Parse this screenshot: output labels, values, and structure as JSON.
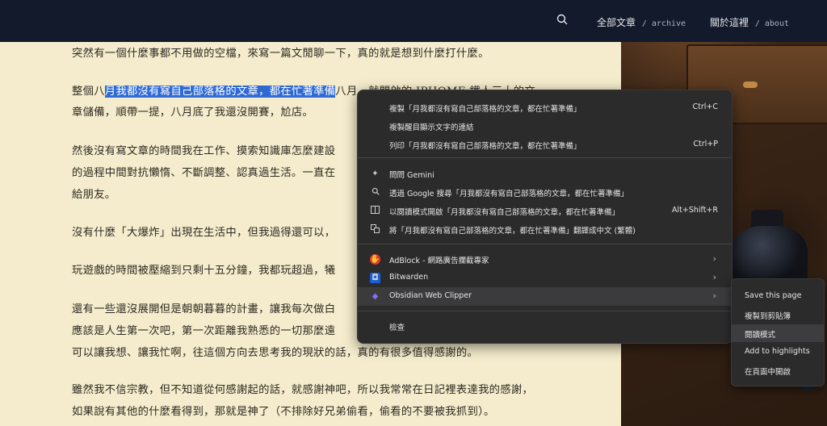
{
  "nav": {
    "items": [
      {
        "label": "全部文章",
        "sub": "/ archive"
      },
      {
        "label": "關於這裡",
        "sub": "/ about"
      }
    ]
  },
  "article": {
    "p1": "突然有一個什麼事都不用做的空檔，來寫一篇文閒聊一下，真的就是想到什麼打什麼。",
    "p2_pre": "整個八",
    "p2_sel": "月我都沒有寫自己部落格的文章，都在忙著準備",
    "p2_post": "八月...就開啟的 IPHOME 鐵人三十的文",
    "p2_l2": "章儲備，順帶一提，八月底了我還沒開賽，尬店。",
    "p3_l1": "然後沒有寫文章的時間我在工作、摸索知識庫怎麼建設",
    "p3_l2": "的過程中間對抗懶惰、不斷調整、認真過生活。一直在",
    "p3_l3": "給朋友。",
    "p4": "沒有什麼「大爆炸」出現在生活中，但我過得還可以，",
    "p5": "玩遊戲的時間被壓縮到只剩十五分鐘，我都玩超過，犧",
    "p6_l1": "還有一些還沒展開但是朝朝暮暮的計畫，讓我每次做白",
    "p6_l2": "應該是人生第一次吧，第一次距離我熟悉的一切那麼遠",
    "p6_l3": "可以讓我想、讓我忙啊，往這個方向去思考我的現狀的話，真的有很多值得感謝的。",
    "p7_l1": "雖然我不信宗教，但不知道從何感謝起的話，就感謝神吧，所以我常常在日記裡表達我的感謝，",
    "p7_l2": "如果說有其他的什麼看得到，那就是神了（不排除好兄弟偷看，偷看的不要被我抓到）。"
  },
  "context_menu": {
    "copy": {
      "label": "複製「月我都沒有寫自己部落格的文章，都在忙著準備」",
      "shortcut": "Ctrl+C"
    },
    "copy_link": {
      "label": "複製醒目顯示文字的連結"
    },
    "print": {
      "label": "列印「月我都沒有寫自己部落格的文章，都在忙著準備」",
      "shortcut": "Ctrl+P"
    },
    "gemini": {
      "label": "問問 Gemini"
    },
    "google": {
      "label": "透過 Google 搜尋「月我都沒有寫自己部落格的文章，都在忙著準備」"
    },
    "reader": {
      "label": "以閱讀模式開啟「月我都沒有寫自己部落格的文章，都在忙著準備」",
      "shortcut": "Alt+Shift+R"
    },
    "translate": {
      "label": "將「月我都沒有寫自己部落格的文章，都在忙著準備」翻譯成中文 (繁體)"
    },
    "adblock": {
      "label": "AdBlock - 網路廣告攔截專家"
    },
    "bitwarden": {
      "label": "Bitwarden"
    },
    "obsidian": {
      "label": "Obsidian Web Clipper"
    },
    "inspect": {
      "label": "檢查"
    }
  },
  "submenu": {
    "items": [
      "Save this page",
      "複製到剪貼簿",
      "閱讀模式",
      "Add to highlights",
      "在頁面中開啟"
    ]
  },
  "colors": {
    "topbar": "#121a2b",
    "paper": "#f4eccc",
    "selection": "#2f6ad4",
    "menu_bg": "#2b2b2c"
  }
}
